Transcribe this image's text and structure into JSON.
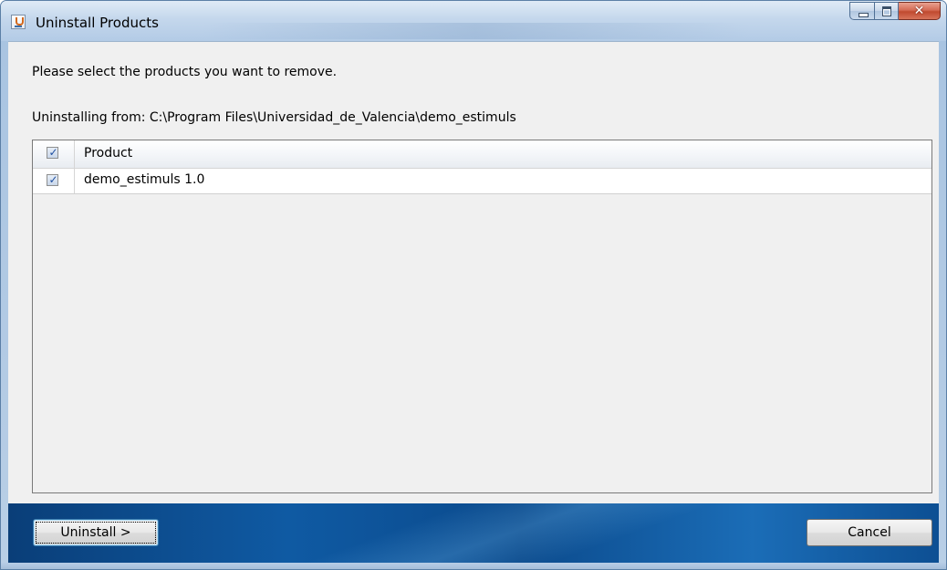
{
  "window": {
    "title": "Uninstall Products"
  },
  "content": {
    "instruction": "Please select the products you want to remove.",
    "location": "Uninstalling from: C:\\Program Files\\Universidad_de_Valencia\\demo_estimuls"
  },
  "table": {
    "header": {
      "product_label": "Product",
      "select_all_checked": true
    },
    "rows": [
      {
        "product": "demo_estimuls 1.0",
        "checked": true
      }
    ]
  },
  "buttons": {
    "uninstall_label": "Uninstall >",
    "cancel_label": "Cancel"
  },
  "icons": {
    "app": "java-installer-icon",
    "minimize": "minimize-icon",
    "maximize": "maximize-icon",
    "close": "close-icon",
    "check": "checkmark-icon"
  },
  "colors": {
    "footer_gradient_start": "#0a3e78",
    "footer_gradient_end": "#1b6db7",
    "close_button": "#c04a2f",
    "checkmark": "#1e4fa0"
  }
}
